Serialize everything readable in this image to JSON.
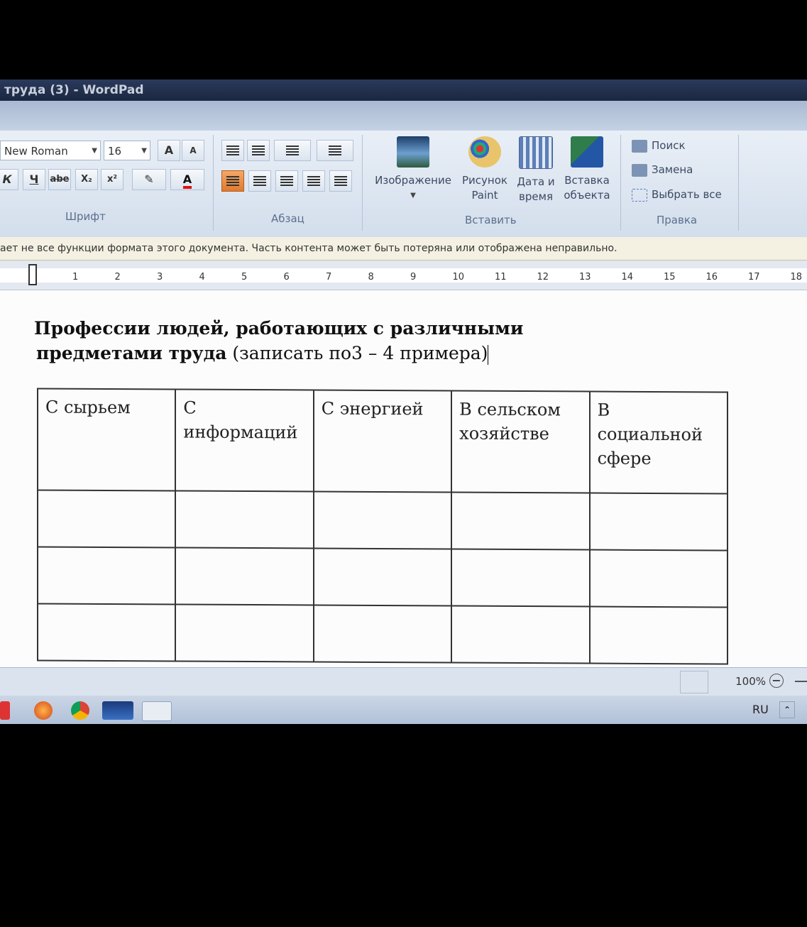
{
  "window": {
    "title": "труда (3) - WordPad"
  },
  "ribbon": {
    "font": {
      "family": "New Roman",
      "size": "16",
      "grow_icon": "grow-font-icon",
      "shrink_icon": "shrink-font-icon",
      "italic": "К",
      "underline": "Ч",
      "strike": "abe",
      "subscript": "X₂",
      "superscript": "x²",
      "highlight_icon": "highlighter-icon",
      "color_glyph": "A",
      "group_label": "Шрифт"
    },
    "paragraph": {
      "group_label": "Абзац"
    },
    "insert": {
      "image": "Изображение",
      "paint_line1": "Рисунок",
      "paint_line2": "Paint",
      "datetime_line1": "Дата и",
      "datetime_line2": "время",
      "object_line1": "Вставка",
      "object_line2": "объекта",
      "group_label": "Вставить"
    },
    "edit": {
      "find": "Поиск",
      "replace": "Замена",
      "select_all": "Выбрать все",
      "group_label": "Правка"
    }
  },
  "infobar": {
    "text": "ает не все функции формата этого документа. Часть контента может быть потеряна или отображена неправильно."
  },
  "ruler": {
    "ticks": [
      "1",
      "2",
      "3",
      "4",
      "5",
      "6",
      "7",
      "8",
      "9",
      "10",
      "11",
      "12",
      "13",
      "14",
      "15",
      "16",
      "17",
      "18"
    ]
  },
  "document": {
    "heading_line1": "Профессии людей, работающих с различными",
    "heading_bold2": "предметами труда",
    "heading_normal2": " (записать по3 – 4 примера)",
    "table": {
      "headers": [
        "С сырьем",
        "С информаций",
        "С энергией",
        "В сельском хозяйстве",
        "В социальной сфере"
      ]
    }
  },
  "statusbar": {
    "zoom": "100%"
  },
  "taskbar": {
    "lang": "RU"
  }
}
